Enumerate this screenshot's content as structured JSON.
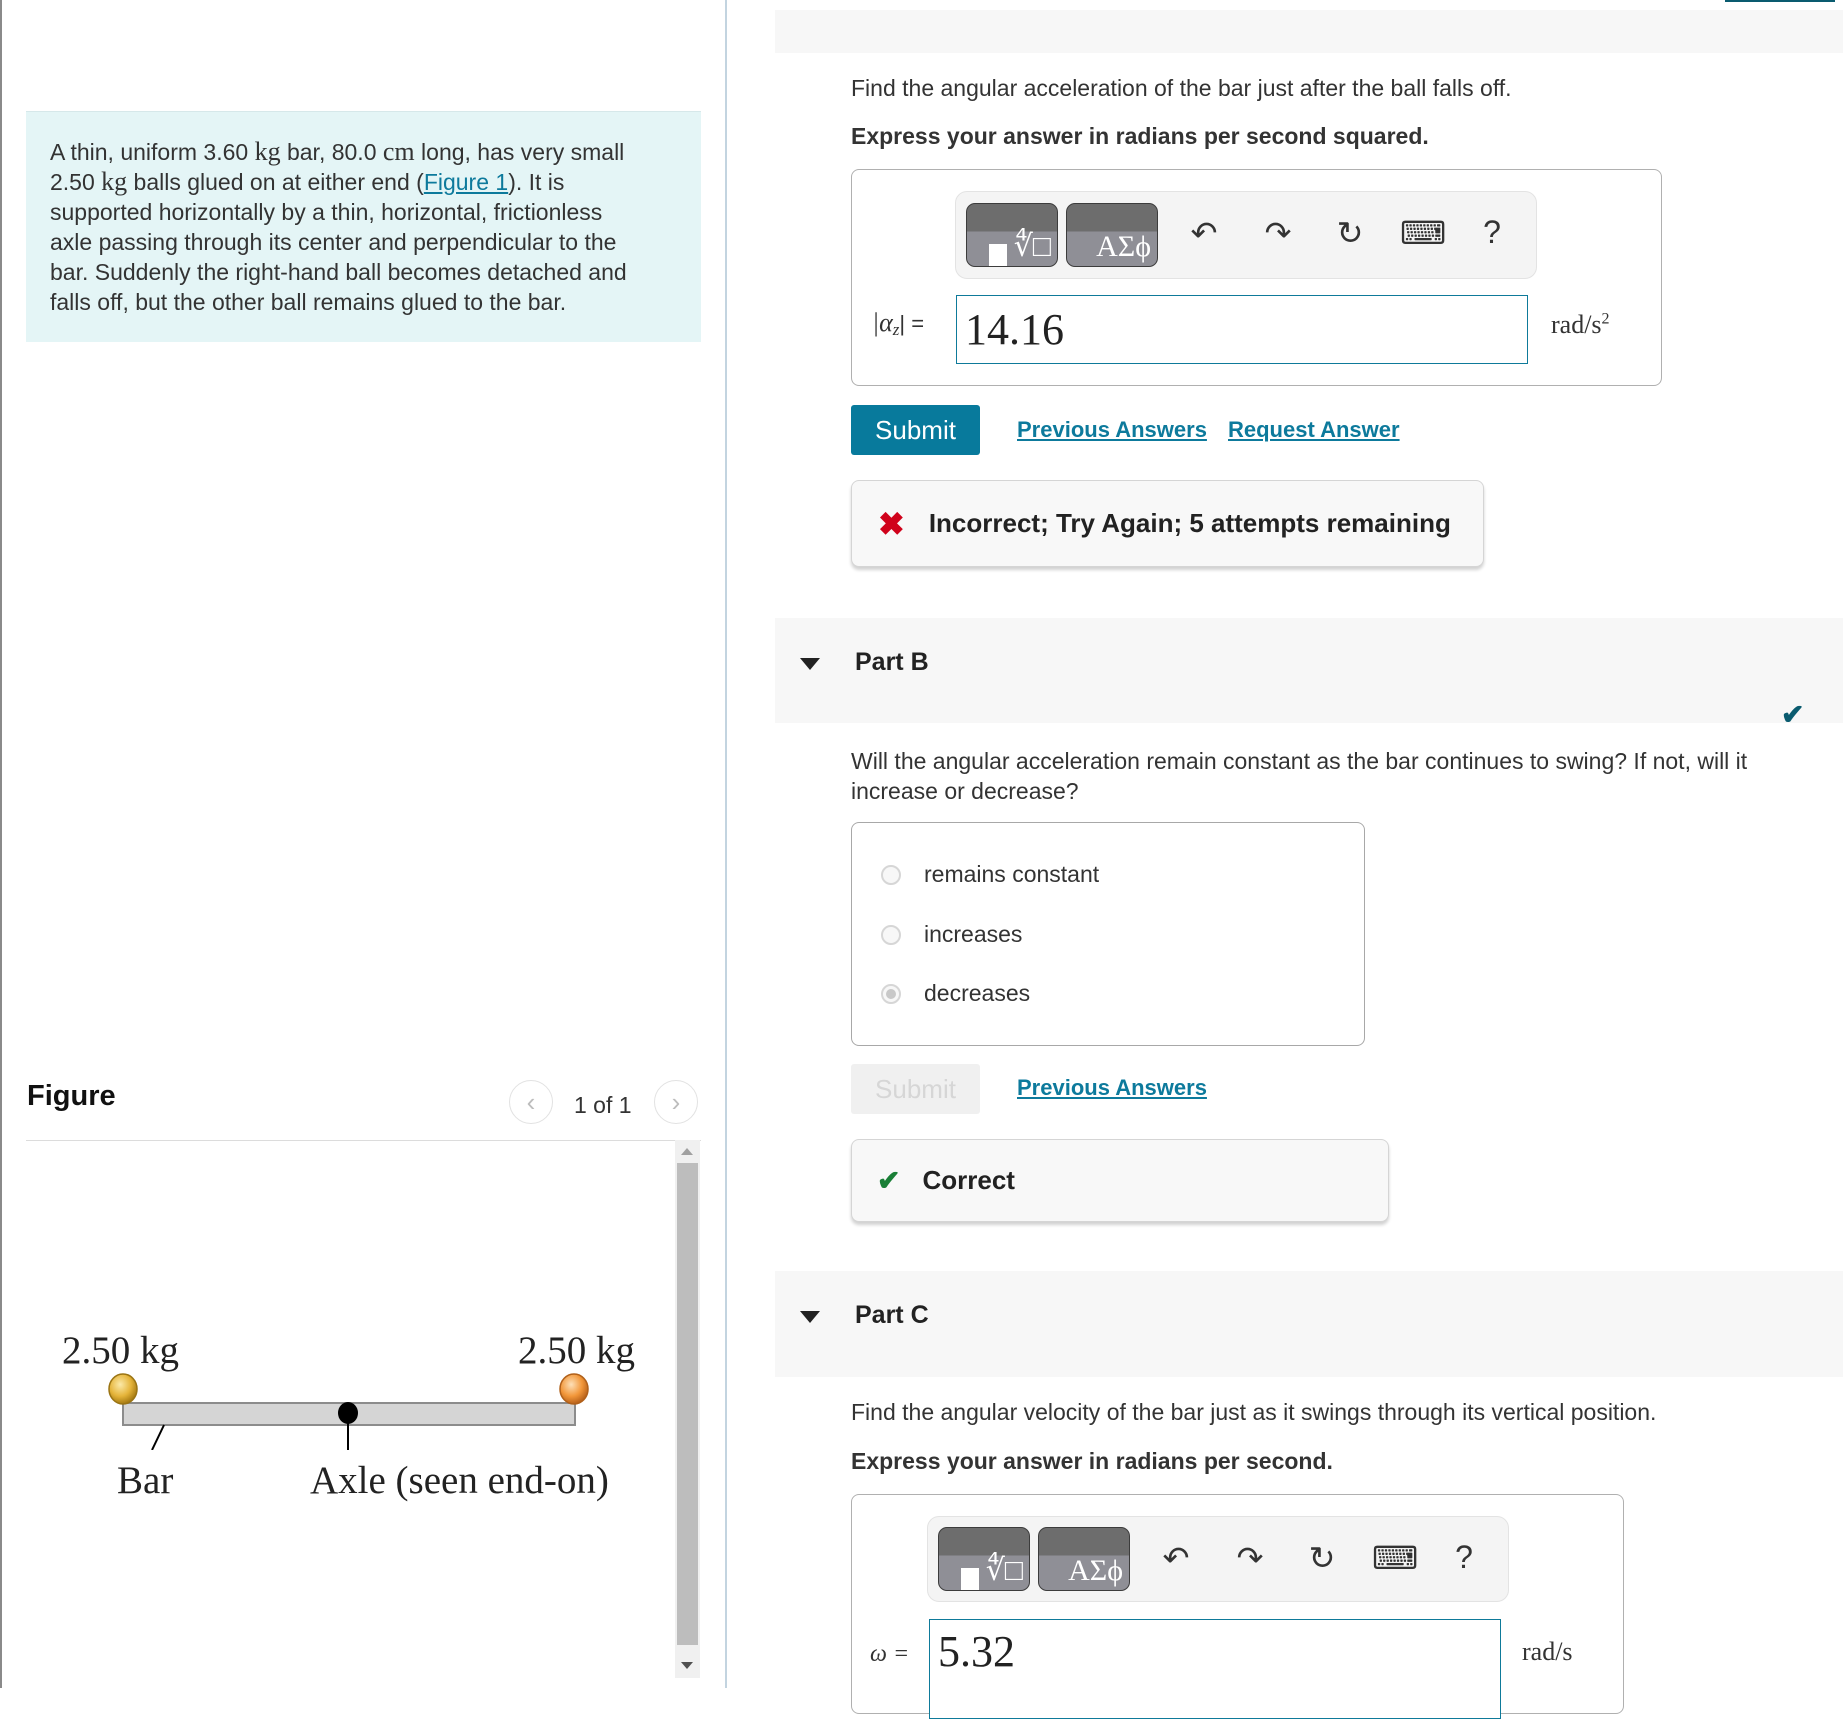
{
  "problem": {
    "seg1": "A thin, uniform 3.60 ",
    "unit_kg_1": "kg",
    "seg2": " bar, 80.0 ",
    "unit_cm": "cm",
    "seg3": " long, has very small",
    "seg4": "2.50 ",
    "unit_kg_2": "kg",
    "seg5": " balls glued on at either end (",
    "figure_link": "Figure 1",
    "seg6": "). It is",
    "line3": "supported horizontally by a thin, horizontal, frictionless",
    "line4": "axle passing through its center and perpendicular to the",
    "line5": "bar. Suddenly the right-hand ball becomes detached and",
    "line6": "falls off, but the other ball remains glued to the bar."
  },
  "figure": {
    "title": "Figure",
    "counter": "1 of 1",
    "prev_icon": "‹",
    "next_icon": "›",
    "left_mass": "2.50 kg",
    "right_mass": "2.50 kg",
    "bar_label": "Bar",
    "axle_label": "Axle (seen end-on)"
  },
  "part_a": {
    "question": "Find the angular acceleration of the bar just after the ball falls off.",
    "instruction": "Express your answer in radians per second squared.",
    "toolbar": {
      "templates_label": "∜□",
      "greek_label": "ΑΣϕ",
      "undo_icon": "↶",
      "redo_icon": "↷",
      "reset_icon": "↻",
      "keyboard_icon": "⌨",
      "help_icon": "?"
    },
    "var_label_left": "|α",
    "var_sub": "z",
    "var_label_right": "| =",
    "answer_value": "14.16",
    "unit": "rad/s",
    "unit_sup": "2",
    "submit_label": "Submit",
    "previous_answers": "Previous Answers",
    "request_answer": "Request Answer",
    "feedback_icon": "✖",
    "feedback": "Incorrect; Try Again; 5 attempts remaining"
  },
  "part_b": {
    "title": "Part B",
    "status_icon": "✔",
    "question_line1": "Will the angular acceleration remain constant as the bar continues to swing? If not, will it",
    "question_line2": "increase or decrease?",
    "options": [
      {
        "label": "remains constant",
        "selected": false
      },
      {
        "label": "increases",
        "selected": false
      },
      {
        "label": "decreases",
        "selected": true
      }
    ],
    "submit_label": "Submit",
    "previous_answers": "Previous Answers",
    "feedback_icon": "✔",
    "feedback": "Correct"
  },
  "part_c": {
    "title": "Part C",
    "question": "Find the angular velocity of the bar just as it swings through its vertical position.",
    "instruction": "Express your answer in radians per second.",
    "toolbar": {
      "templates_label": "∜□",
      "greek_label": "ΑΣϕ",
      "undo_icon": "↶",
      "redo_icon": "↷",
      "reset_icon": "↻",
      "keyboard_icon": "⌨",
      "help_icon": "?"
    },
    "var_label": "ω =",
    "answer_value": "5.32",
    "unit": "rad/s"
  },
  "colors": {
    "accent": "#087a9c",
    "link": "#0d7a9c",
    "incorrect": "#d0021b",
    "correct": "#1a7f37",
    "problem_bg": "#e4f5f6"
  }
}
